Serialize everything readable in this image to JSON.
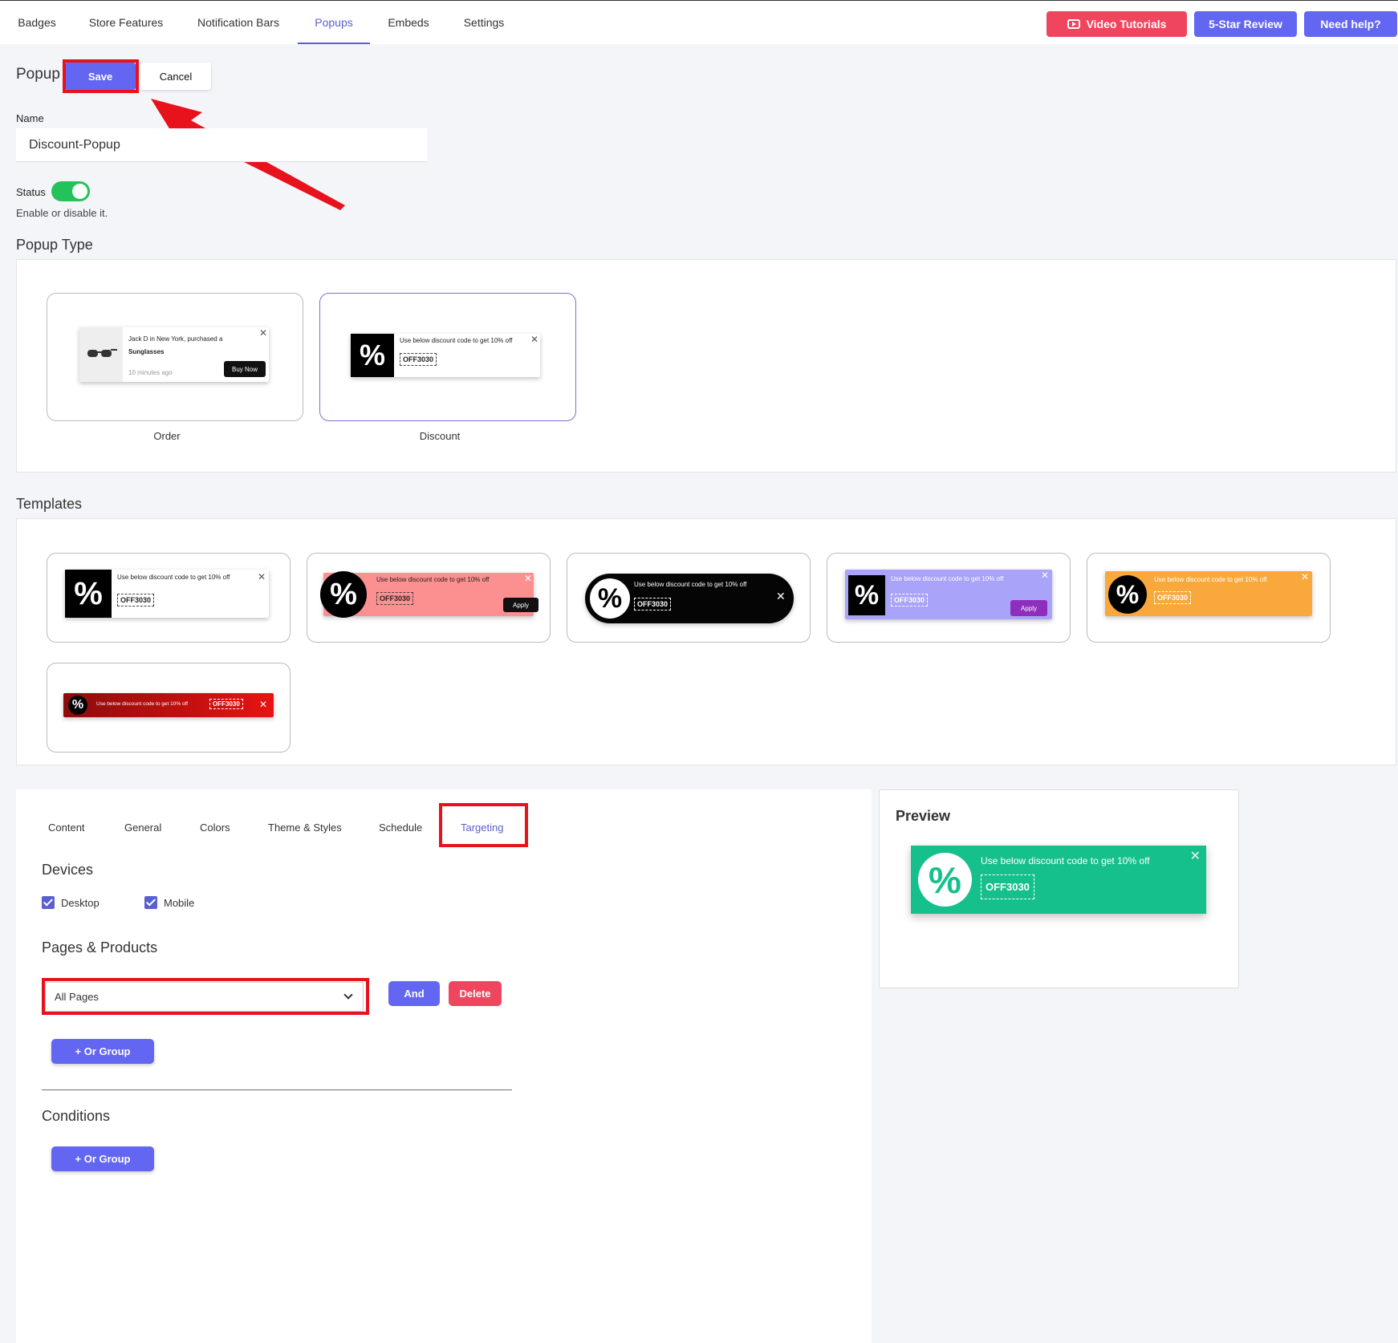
{
  "nav": {
    "tabs": [
      "Badges",
      "Store Features",
      "Notification Bars",
      "Popups",
      "Embeds",
      "Settings"
    ],
    "active_tab": "Popups",
    "video_label": "Video Tutorials",
    "review_label": "5-Star Review",
    "help_label": "Need help?"
  },
  "header": {
    "title": "Popup",
    "save_label": "Save",
    "cancel_label": "Cancel"
  },
  "name": {
    "label": "Name",
    "value": "Discount-Popup"
  },
  "status": {
    "label": "Status",
    "help": "Enable or disable it.",
    "enabled": true
  },
  "popup_type": {
    "title": "Popup Type",
    "options": [
      {
        "label": "Order",
        "sample_text": "Jack D in New York, purchased a",
        "product": "Sunglasses",
        "time": "10 minutes ago",
        "button": "Buy Now"
      },
      {
        "label": "Discount",
        "sample_text": "Use below discount code to get 10% off",
        "code": "OFF3030"
      }
    ],
    "selected": "Discount"
  },
  "templates": {
    "title": "Templates",
    "text": "Use below discount code to get 10% off",
    "code": "OFF3030",
    "apply_label": "Apply",
    "colors": [
      "#ffffff",
      "#fc8f8f",
      "#050505",
      "#a9a3f9",
      "#f9a93b",
      "#e81313"
    ]
  },
  "settings_tabs": {
    "items": [
      "Content",
      "General",
      "Colors",
      "Theme & Styles",
      "Schedule",
      "Targeting"
    ],
    "active": "Targeting"
  },
  "devices": {
    "title": "Devices",
    "desktop": "Desktop",
    "mobile": "Mobile",
    "desktop_checked": true,
    "mobile_checked": true
  },
  "pages": {
    "title": "Pages & Products",
    "select_value": "All Pages",
    "and_label": "And",
    "delete_label": "Delete",
    "or_group_label": "+ Or Group"
  },
  "conditions": {
    "title": "Conditions",
    "or_group_label": "+ Or Group"
  },
  "preview": {
    "title": "Preview",
    "text": "Use below discount code to get 10% off",
    "code": "OFF3030",
    "color": "#16c08c"
  },
  "icons": {
    "percent": "%",
    "close": "✕"
  }
}
